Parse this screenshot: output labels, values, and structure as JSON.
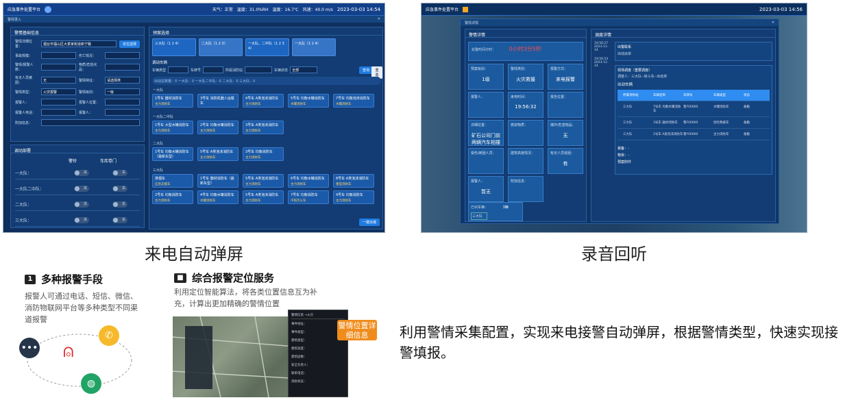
{
  "screen1": {
    "app_title": "应急事件处置平台",
    "weather": "天气：正常",
    "humidity": "温度：31.0%RH",
    "temperature": "温度：16.7℃",
    "wind": "风速：40.0 m/s",
    "datetime": "2023-03-03 14:54",
    "window_label": "警情录入",
    "left_panel_title": "警情基础信息",
    "fields": [
      {
        "label": "警情详细位置：",
        "value": "烟台市福山区大季家街道新宁路",
        "button": "定位选择"
      },
      {
        "label": "事故规模：",
        "value": "",
        "label2": "伤亡情况：",
        "value2": ""
      },
      {
        "label": "警情/报警人数：",
        "value": "",
        "label2": "物质/危险化品：",
        "value2": ""
      },
      {
        "label": "有无人员被困：",
        "value": "无",
        "label2": "警情特征：",
        "value2": "请选择类"
      },
      {
        "label": "警情类型：",
        "value": "火灾报警",
        "label2": "警情级别：",
        "value2": "一级"
      },
      {
        "label": "报警人：",
        "value": "",
        "label2": "报警人位置：",
        "value2": ""
      },
      {
        "label": "报警人电话：",
        "value": "",
        "label2": "报警人：",
        "value2": ""
      },
      {
        "label": "附加信息：",
        "value": ""
      }
    ],
    "dispatch_panel_title": "调动部署",
    "dispatch_headers": [
      "警铃",
      "车库卷门"
    ],
    "dispatch_rows": [
      {
        "name": "一大队：",
        "bell": "关",
        "door": "关"
      },
      {
        "name": "一大队二中队：",
        "bell": "关",
        "door": "关"
      },
      {
        "name": "二大队：",
        "bell": "关",
        "door": "关"
      },
      {
        "name": "三大队：",
        "bell": "关",
        "door": "关"
      }
    ],
    "right_panel_title": "预案选择",
    "plans": [
      "三大队（1 2 4）",
      "二大队（1 2 3）",
      "一大队、二中队（1 2 3 4）",
      "一大队（1 2 4）"
    ],
    "vehicle_section_title": "调动车辆",
    "filter_labels": [
      "车辆类型",
      "车牌号",
      "所属消防站",
      "车辆状态"
    ],
    "filter_status_value": "全部",
    "query_button": "查询",
    "reset_button": "重置",
    "summary_text": "出动总数量：0    一大队：0    一大队二中队：0    二大队：0    三大队：0",
    "groups": [
      {
        "name": "一大队",
        "vehicles": [
          [
            "1号车 器材消防车",
            "主力消防车"
          ],
          [
            "3号车 消防机器人运载车",
            "主力消防车"
          ],
          [
            "4号车 A类泡沫消防车",
            "主力消防车"
          ],
          [
            "5号车 均衡水罐消防车",
            "水罐消防车"
          ],
          [
            "7号车 均衡泡沫消防车",
            "水罐消防车"
          ]
        ]
      },
      {
        "name": "一大队二中队",
        "vehicles": [
          [
            "1号车 大型水罐消防车",
            "主力消防车"
          ],
          [
            "2号车 均衡水罐消防车",
            "主力消防车"
          ],
          [
            "3号车 A类泡沫消防车",
            "主力消防车"
          ]
        ]
      },
      {
        "name": "二大队",
        "vehicles": [
          [
            "1号车 均衡水罐消防车（最新车型）",
            "重型消防车"
          ],
          [
            "5号车 A类泡沫消防车",
            "主力消防车"
          ],
          [
            "3号车 均衡消防车",
            "主力消防车"
          ]
        ]
      },
      {
        "name": "三大队",
        "vehicles": [
          [
            "排烟车",
            "应急支援车"
          ],
          [
            "1号车 器材消防车（最新车型）",
            "重型消防车"
          ],
          [
            "5号车 A类泡沫消防车",
            "主力消防车"
          ],
          [
            "6号车 均衡水罐消防车",
            "主力消防车"
          ],
          [
            "8号车 A类泡沫消防车",
            "重型消防车"
          ],
          [
            "2号车 均衡消防车",
            "主力消防车"
          ],
          [
            "4号车 均衡水罐消防车",
            "水罐消防车"
          ],
          [
            "5号车 A类泡沫消防车",
            "主力消防车"
          ],
          [
            "7号车 均衡消防车",
            "干粉灭火车"
          ],
          [
            "9号车 均衡消防车",
            "主力消防车"
          ]
        ]
      }
    ],
    "assign_tag": "备勤",
    "submit_button": "一键派遣"
  },
  "screen2": {
    "app_title": "应急事件处置平台",
    "datetime": "2023-03-03 14:56",
    "window_label": "警情详情",
    "left_title": "警情详情",
    "timer_label": "处警时间计时：",
    "timer_value": "0小时3分5秒",
    "cards": [
      {
        "label": "预案级别：",
        "value": "1级"
      },
      {
        "label": "警情类别：",
        "value": "火灾救援"
      },
      {
        "label": "报警方式：",
        "value": "来电报警"
      },
      {
        "label": "报警人：",
        "value": ""
      },
      {
        "label": "来电时间：",
        "value": "19:56:32"
      },
      {
        "label": "报告位置：",
        "value": ""
      },
      {
        "label": "详细位置：",
        "value": "矿石公司门前两辆汽车相撞"
      },
      {
        "label": "燃烧物质：",
        "value": ""
      },
      {
        "label": "爆炸/危害物品：",
        "value": "无"
      },
      {
        "label": "受伤/被困人员：",
        "value": ""
      },
      {
        "label": "建筑高度情况：",
        "value": ""
      },
      {
        "label": "有无人员受困：",
        "value": "有"
      },
      {
        "label": "报警人：",
        "value": "暂无"
      },
      {
        "label": "附加信息：",
        "value": ""
      }
    ],
    "dispatched_label": "已出车辆：",
    "dispatched_count": "3辆",
    "dispatched_unit": "三大队",
    "timeline": [
      {
        "time": "19:56:27",
        "date": "2023-11-14"
      },
      {
        "time": "19:56:53",
        "date": "2023-11-14"
      }
    ],
    "record_title": "调度详情",
    "notice_title": "出警联系",
    "notice_text": "出动派单",
    "record_section": "现场调度（重要调度）",
    "record_subtext": "调度人：三大队--徐斗东--出动单",
    "vehicles_title": "出动车辆",
    "table_headers": [
      "所属消防站",
      "车辆名称",
      "车牌号",
      "车辆类型",
      "状态"
    ],
    "table_rows": [
      [
        "三大队",
        "7号车 均衡水罐消防车",
        "鲁F00000",
        "水罐消防车",
        "备勤"
      ],
      [
        "三大队",
        "3号车 器材消防车",
        "鲁F00000",
        "抢险救援车",
        "备勤"
      ],
      [
        "三大队",
        "2号车 A类泡沫消防车",
        "鲁F00000",
        "主力消防车",
        "备勤"
      ]
    ],
    "footer_lines": [
      "装备：-",
      "物资：-",
      "预案附件"
    ]
  },
  "captions": {
    "left": "来电自动弹屏",
    "right": "录音回听"
  },
  "feature1": {
    "title": "多种报警手段",
    "desc": "报警人可通过电话、短信、微信、消防物联网平台等多种类型不同渠道报警"
  },
  "feature2": {
    "title": "综合报警定位服务",
    "desc": "利用定位智能算法，将各类位置信息互为补充，计算出更加精确的警情位置",
    "overlay_title": "警情位置详细信息",
    "info_header": "警情信息 →火灾",
    "info_lines": [
      "事件地址：",
      "事件类型：",
      "建筑类型：",
      "建筑高度：",
      "建筑层数：",
      "安全负责人：",
      "联系电话：",
      "消防状态："
    ]
  },
  "main_text": "利用警情采集配置，实现来电接警自动弹屏，根据警情类型，快速实现接警填报。",
  "colors": {
    "accent": "#1f7be0",
    "panel": "#123c73",
    "alert_red": "#e02020",
    "orange": "#f08c1c"
  }
}
